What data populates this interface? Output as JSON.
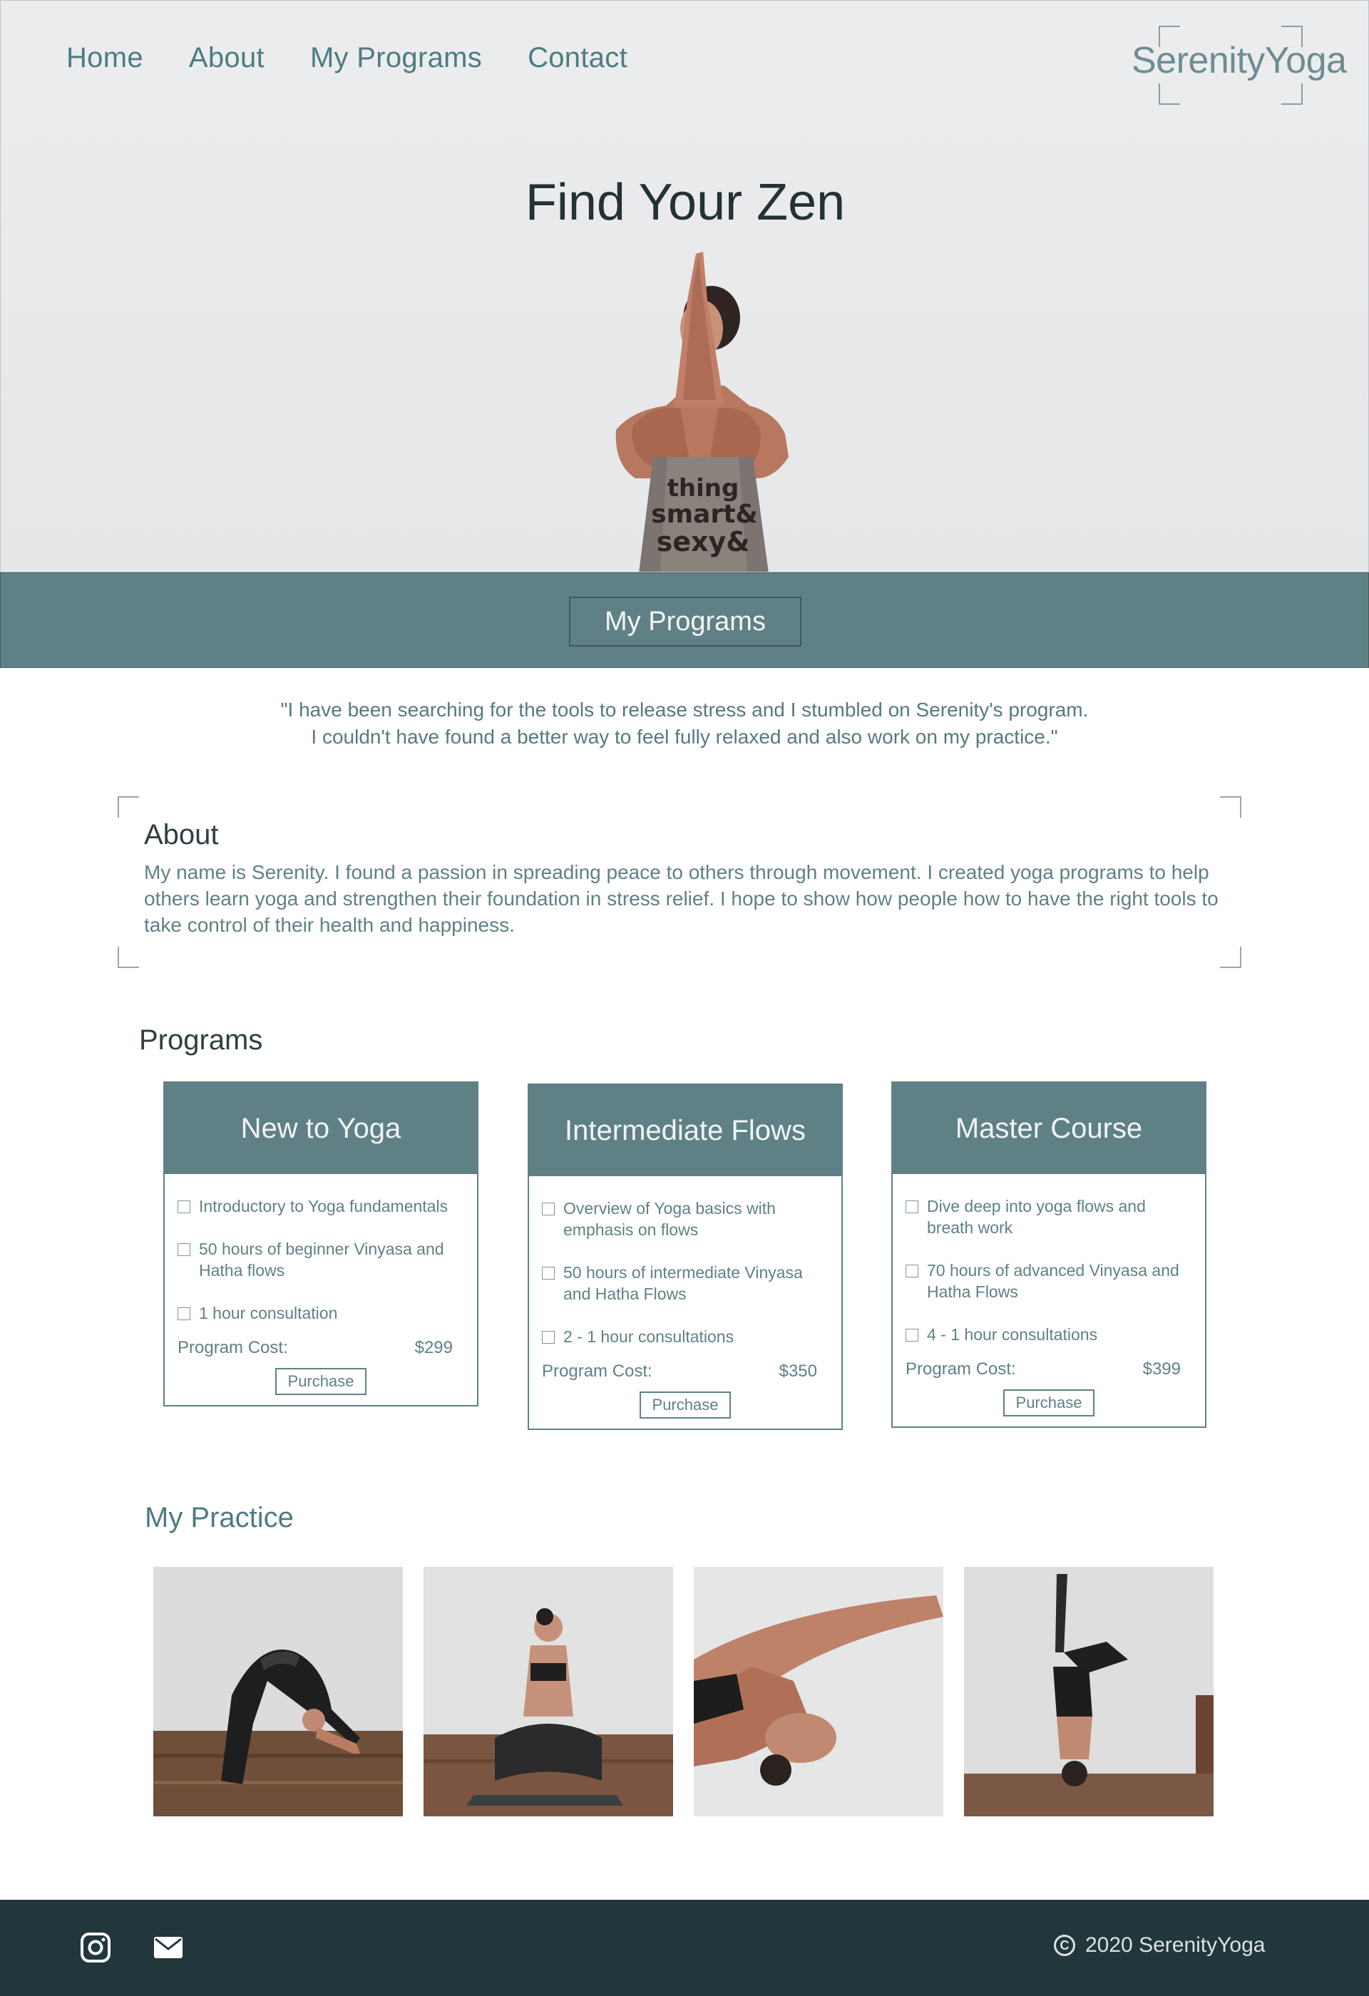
{
  "nav": {
    "items": [
      {
        "label": "Home"
      },
      {
        "label": "About"
      },
      {
        "label": "My Programs"
      },
      {
        "label": "Contact"
      }
    ]
  },
  "logo": {
    "text": "SerenityYoga"
  },
  "hero": {
    "title": "Find Your Zen",
    "shirt_text": [
      "thing",
      "smart&",
      "sexy&"
    ]
  },
  "band": {
    "button_label": "My Programs"
  },
  "testimonial": {
    "line1": "\"I have been searching for the tools to release stress and I stumbled on Serenity's program.",
    "line2": "I couldn't have found a better way to feel fully relaxed and also work on my practice.\""
  },
  "about": {
    "title": "About",
    "body": "My name is Serenity. I found a passion in spreading peace to others through movement. I created yoga programs to help others learn yoga and strengthen their foundation in stress relief. I hope to show how people how to have the right tools to take control of their health and happiness."
  },
  "programs": {
    "title": "Programs",
    "cards": [
      {
        "name": "New to Yoga",
        "features": [
          "Introductory to Yoga fundamentals",
          "50 hours of beginner Vinyasa and Hatha flows",
          "1 hour consultation"
        ],
        "cost_label": "Program Cost:",
        "price": "$299",
        "button": "Purchase"
      },
      {
        "name": "Intermediate Flows",
        "features": [
          "Overview of Yoga basics with emphasis on flows",
          "50 hours of intermediate Vinyasa and Hatha Flows",
          "2 - 1 hour consultations"
        ],
        "cost_label": "Program Cost:",
        "price": "$350",
        "button": "Purchase"
      },
      {
        "name": "Master Course",
        "features": [
          "Dive deep into yoga flows and breath work",
          "70 hours of advanced Vinyasa and Hatha Flows",
          "4 - 1 hour consultations"
        ],
        "cost_label": "Program Cost:",
        "price": "$399",
        "button": "Purchase"
      }
    ]
  },
  "practice": {
    "title": "My Practice"
  },
  "footer": {
    "icons": [
      "instagram-icon",
      "mail-icon"
    ],
    "copyright": "2020 SerenityYoga"
  },
  "colors": {
    "teal": "#5f8186",
    "dark_footer": "#22373b",
    "hero_bg": "#eaebed"
  }
}
